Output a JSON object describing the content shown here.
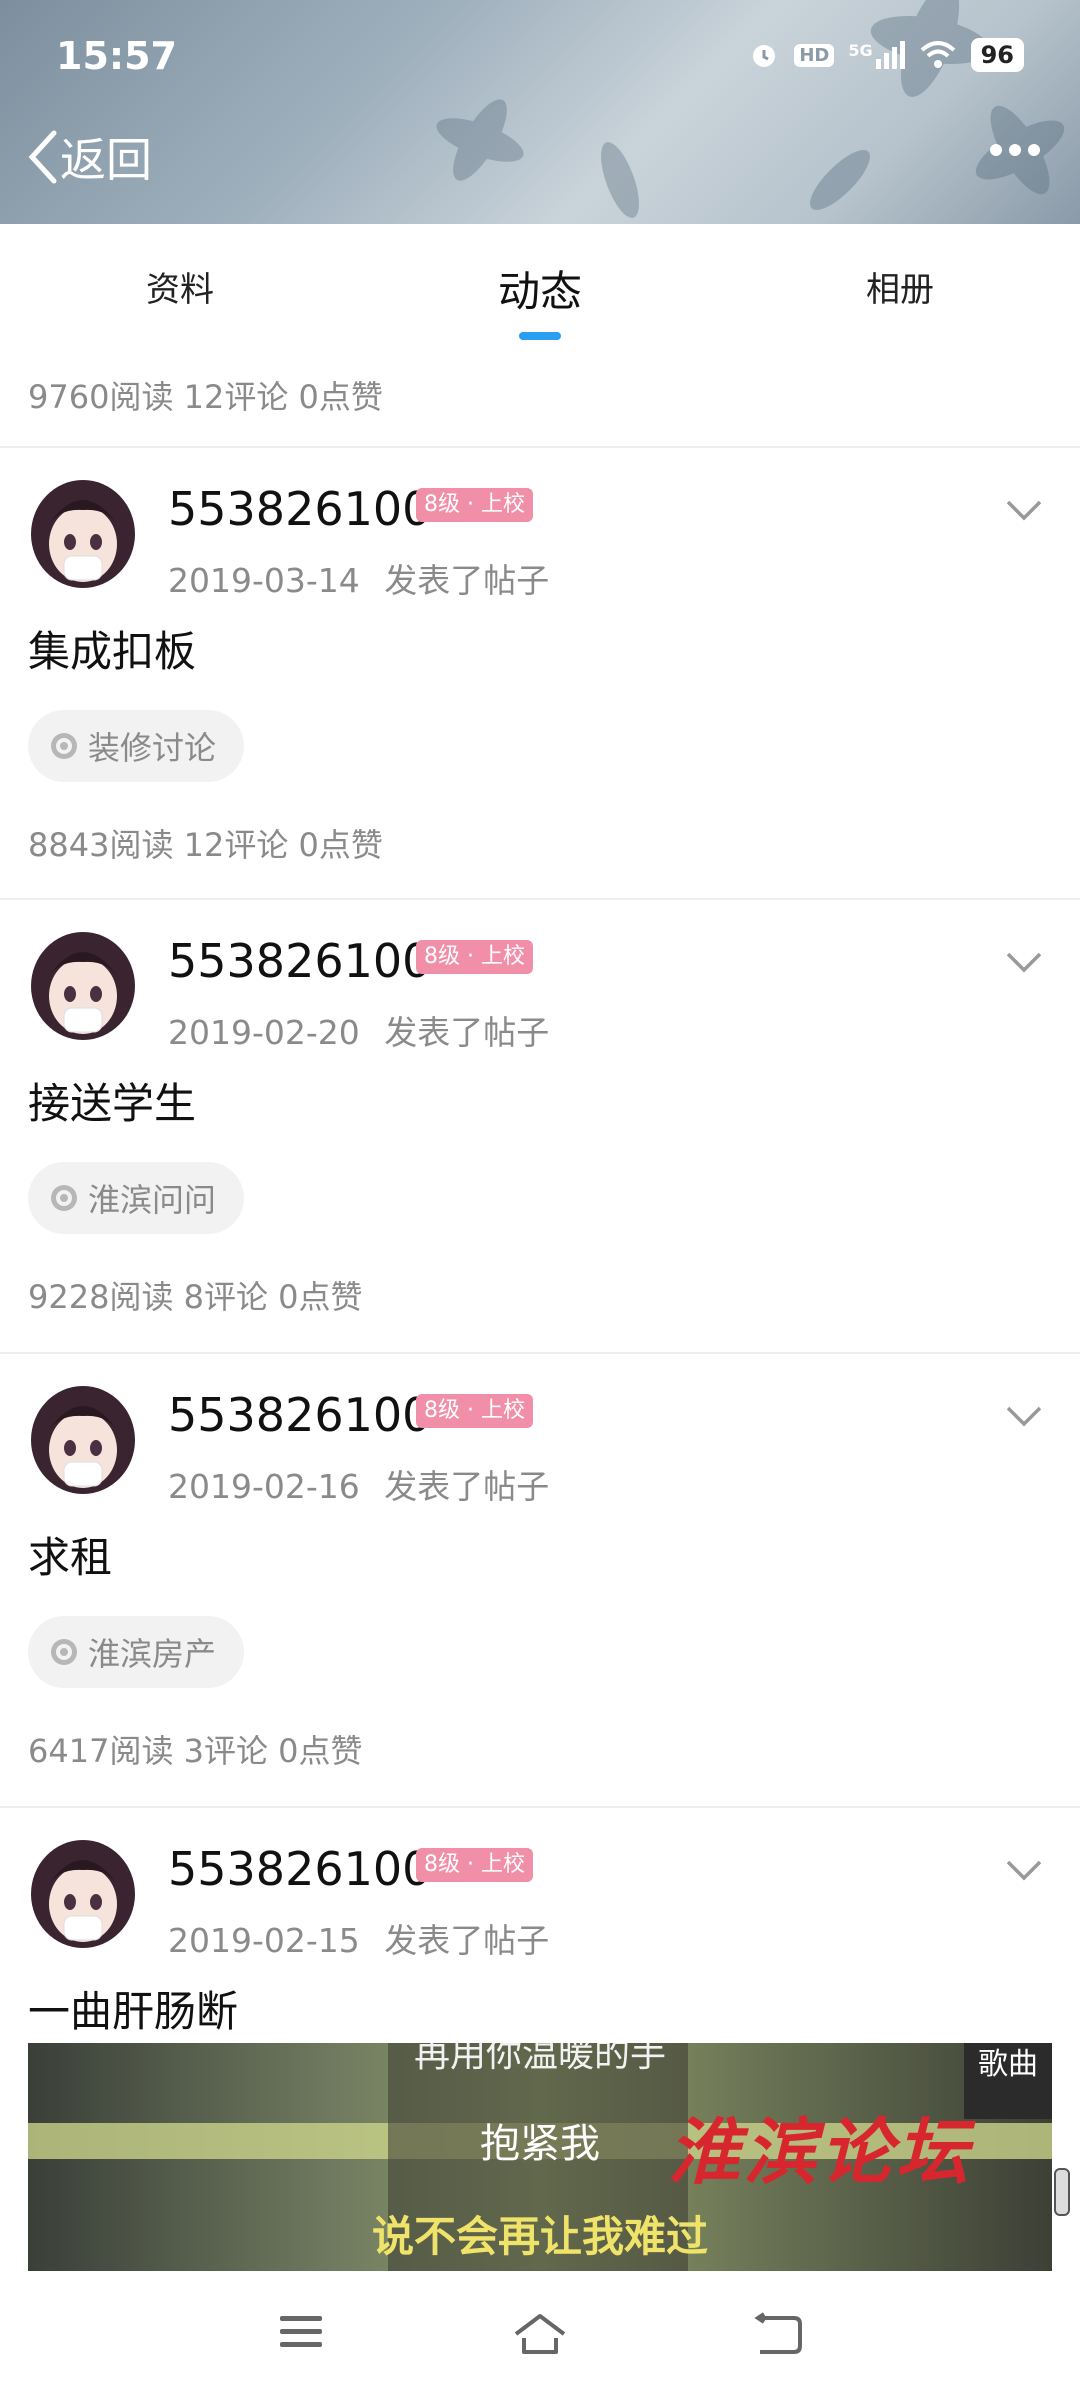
{
  "status_bar": {
    "time": "15:57",
    "battery": "96",
    "hd_label": "HD",
    "network_label": "5G"
  },
  "header": {
    "back_label": "返回"
  },
  "tabs": [
    {
      "label": "资料",
      "active": false
    },
    {
      "label": "动态",
      "active": true
    },
    {
      "label": "相册",
      "active": false
    }
  ],
  "summary": "9760阅读 12评论 0点赞",
  "posts": [
    {
      "username": "553826100",
      "level": "8级 · 上校",
      "date": "2019-03-14",
      "action": "发表了帖子",
      "title": "集成扣板",
      "forum": "装修讨论",
      "stats": "8843阅读 12评论 0点赞"
    },
    {
      "username": "553826100",
      "level": "8级 · 上校",
      "date": "2019-02-20",
      "action": "发表了帖子",
      "title": "接送学生",
      "forum": "淮滨问问",
      "stats": "9228阅读 8评论 0点赞"
    },
    {
      "username": "553826100",
      "level": "8级 · 上校",
      "date": "2019-02-16",
      "action": "发表了帖子",
      "title": "求租",
      "forum": "淮滨房产",
      "stats": "6417阅读 3评论 0点赞"
    },
    {
      "username": "553826100",
      "level": "8级 · 上校",
      "date": "2019-02-15",
      "action": "发表了帖子",
      "title": "一曲肝肠断"
    }
  ],
  "video": {
    "subtitle_top": "再用你温暖的手",
    "subtitle_mid": "抱紧我",
    "subtitle_bottom": "说不会再让我难过",
    "watermark": "淮滨论坛",
    "song_tag": "歌曲"
  },
  "colors": {
    "accent": "#2a9ef0",
    "badge": "#f28fa8",
    "watermark": "#d8262e"
  }
}
